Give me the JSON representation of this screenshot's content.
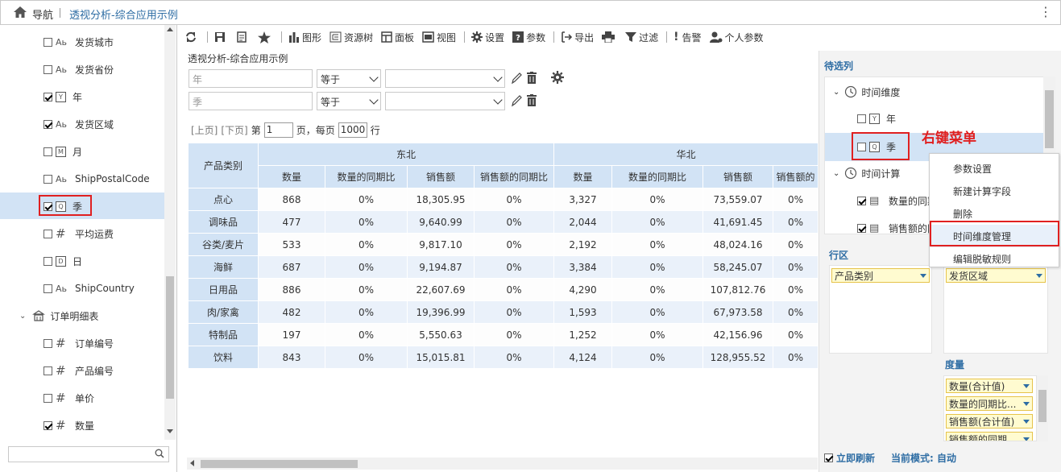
{
  "topbar": {
    "nav_label": "导航",
    "title": "透视分析-综合应用示例"
  },
  "left_tree": {
    "items": [
      {
        "label": "发货城市",
        "checked": false,
        "icon": "Ab"
      },
      {
        "label": "发货省份",
        "checked": false,
        "icon": "Ab"
      },
      {
        "label": "年",
        "checked": true,
        "icon": "Y"
      },
      {
        "label": "发货区域",
        "checked": true,
        "icon": "Ab"
      },
      {
        "label": "月",
        "checked": false,
        "icon": "M"
      },
      {
        "label": "ShipPostalCode",
        "checked": false,
        "icon": "Ab"
      },
      {
        "label": "季",
        "checked": true,
        "icon": "Q"
      },
      {
        "label": "平均运费",
        "checked": false,
        "icon": "#"
      },
      {
        "label": "日",
        "checked": false,
        "icon": "D"
      },
      {
        "label": "ShipCountry",
        "checked": false,
        "icon": "Ab"
      }
    ],
    "group_label": "订单明细表",
    "group_items": [
      {
        "label": "订单编号",
        "checked": false,
        "icon": "#"
      },
      {
        "label": "产品编号",
        "checked": false,
        "icon": "#"
      },
      {
        "label": "单价",
        "checked": false,
        "icon": "#"
      },
      {
        "label": "数量",
        "checked": true,
        "icon": "#"
      }
    ]
  },
  "toolbar": {
    "graph": "图形",
    "resource_tree": "资源树",
    "panel": "面板",
    "view": "视图",
    "settings": "设置",
    "params": "参数",
    "export": "导出",
    "filter": "过滤",
    "alert": "告警",
    "personal_params": "个人参数"
  },
  "subtitle": "透视分析-综合应用示例",
  "filters": [
    {
      "field_placeholder": "年",
      "operator": "等于"
    },
    {
      "field_placeholder": "季",
      "operator": "等于"
    }
  ],
  "pager": {
    "prev": "[上页]",
    "next": "[下页]",
    "page_prefix": "第",
    "page_value": "1",
    "page_suffix": "页，每页",
    "size_value": "1000",
    "size_suffix": "行"
  },
  "pivot": {
    "row_header": "产品类别",
    "groups": [
      "东北",
      "华北"
    ],
    "columns": [
      "数量",
      "数量的同期比",
      "销售额",
      "销售额的同期比",
      "数量",
      "数量的同期比",
      "销售额",
      "销售额的"
    ],
    "rows": [
      {
        "label": "点心",
        "cells": [
          "868",
          "0%",
          "18,305.95",
          "0%",
          "3,327",
          "0%",
          "73,559.07",
          "0%"
        ]
      },
      {
        "label": "调味品",
        "cells": [
          "477",
          "0%",
          "9,640.99",
          "0%",
          "2,044",
          "0%",
          "41,691.45",
          "0%"
        ]
      },
      {
        "label": "谷类/麦片",
        "cells": [
          "533",
          "0%",
          "9,817.10",
          "0%",
          "2,192",
          "0%",
          "48,024.16",
          "0%"
        ]
      },
      {
        "label": "海鲜",
        "cells": [
          "687",
          "0%",
          "9,194.87",
          "0%",
          "3,384",
          "0%",
          "58,245.07",
          "0%"
        ]
      },
      {
        "label": "日用品",
        "cells": [
          "886",
          "0%",
          "22,607.69",
          "0%",
          "4,290",
          "0%",
          "107,812.76",
          "0%"
        ]
      },
      {
        "label": "肉/家禽",
        "cells": [
          "482",
          "0%",
          "19,396.99",
          "0%",
          "1,593",
          "0%",
          "67,973.58",
          "0%"
        ]
      },
      {
        "label": "特制品",
        "cells": [
          "197",
          "0%",
          "5,550.63",
          "0%",
          "1,252",
          "0%",
          "42,156.96",
          "0%"
        ]
      },
      {
        "label": "饮料",
        "cells": [
          "843",
          "0%",
          "15,015.81",
          "0%",
          "4,124",
          "0%",
          "128,955.52",
          "0%"
        ]
      }
    ]
  },
  "right_panel": {
    "candidates_title": "待选列",
    "time_dim": "时间维度",
    "year": "年",
    "quarter": "季",
    "time_calc": "时间计算",
    "calc1": "数量的同期",
    "calc2": "销售额的同",
    "row_zone_title": "行区",
    "row_chip": "产品类别",
    "col_chip": "发货区域",
    "measure_title": "度量",
    "measures": [
      "数量(合计值)",
      "数量的同期比...",
      "销售额(合计值)",
      "销售额的同期..."
    ],
    "auto_refresh": "立即刷新",
    "mode": "当前模式: 自动"
  },
  "context_menu": {
    "items": [
      "参数设置",
      "新建计算字段",
      "删除",
      "时间维度管理",
      "编辑脱敏规则"
    ]
  },
  "annotation": "右键菜单",
  "colors": {
    "accent": "#2e6da4",
    "highlight": "#d2e3f5",
    "red": "#e02020"
  }
}
